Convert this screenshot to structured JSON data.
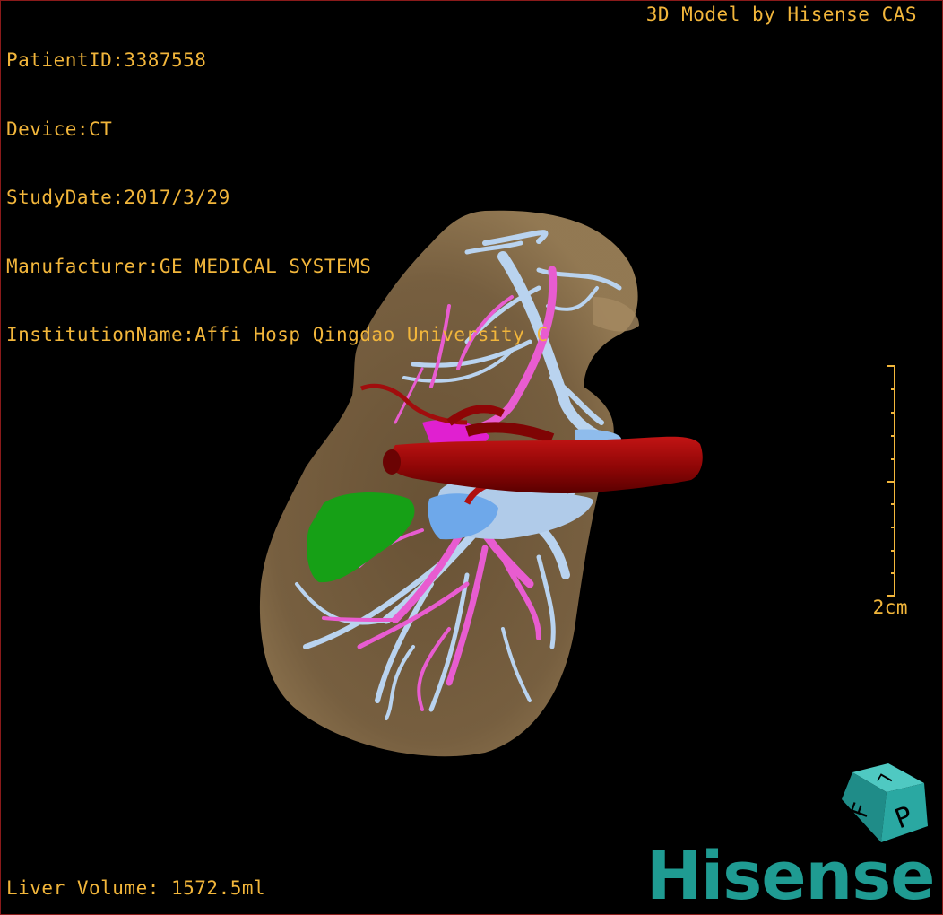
{
  "header": {
    "patient_id": "PatientID:3387558",
    "device": "Device:CT",
    "study_date": "StudyDate:2017/3/29",
    "manufacturer": "Manufacturer:GE MEDICAL SYSTEMS",
    "institution": "InstitutionName:Affi Hosp Qingdao University C",
    "credit": "3D Model by Hisense CAS"
  },
  "scale": {
    "label": "2cm"
  },
  "footer": {
    "volume": "Liver Volume: 1572.5ml"
  },
  "brand": {
    "name": "Hisense"
  },
  "orientation_cube": {
    "face_left": "F",
    "face_right": "P",
    "face_top": "L"
  },
  "model": {
    "structures": [
      "liver",
      "portal-vein",
      "hepatic-vein",
      "hepatic-artery",
      "gallbladder",
      "inferior-vena-cava"
    ],
    "colors": {
      "liver": "#7a6040",
      "hepatic_vein": "#b9d3ef",
      "portal_vein": "#e85cd0",
      "artery": "#9a0a0a",
      "gallbladder": "#1fa21f",
      "accent_text": "#f2b63b",
      "brand": "#1f9b92"
    }
  }
}
